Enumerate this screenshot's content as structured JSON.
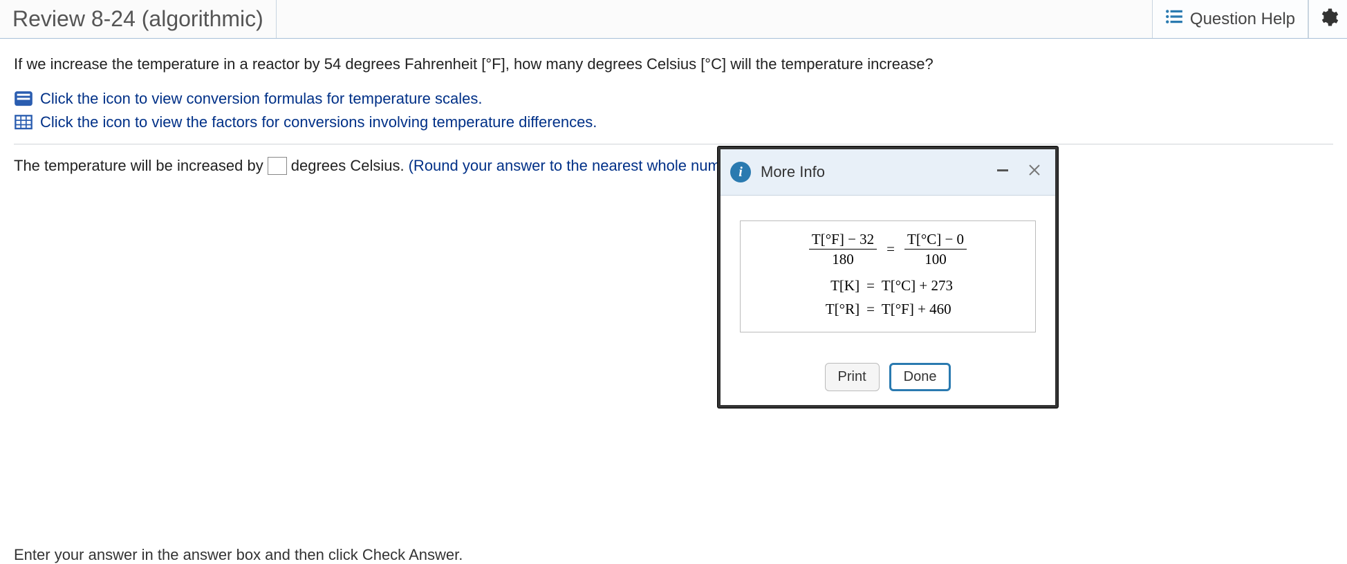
{
  "header": {
    "title": "Review 8-24 (algorithmic)",
    "question_help": "Question Help"
  },
  "question": {
    "prompt": "If we increase the temperature in a reactor by 54 degrees Fahrenheit [°F], how many degrees Celsius [°C] will the temperature increase?",
    "ref1": "Click the icon to view conversion formulas for temperature scales.",
    "ref2": "Click the icon to view the factors for conversions involving temperature differences."
  },
  "answer": {
    "prefix": "The temperature will be increased by",
    "suffix": "degrees Celsius.",
    "hint": "(Round your answer to the nearest whole numbe"
  },
  "popup": {
    "title": "More Info",
    "formula_frac_num_left": "T[°F] − 32",
    "formula_frac_den_left": "180",
    "formula_frac_num_right": "T[°C] − 0",
    "formula_frac_den_right": "100",
    "eq2_lhs": "T[K]",
    "eq2_rhs": "T[°C] + 273",
    "eq3_lhs": "T[°R]",
    "eq3_rhs": "T[°F] + 460",
    "print": "Print",
    "done": "Done"
  },
  "footer": {
    "text": "Enter your answer in the answer box and then click Check Answer."
  }
}
